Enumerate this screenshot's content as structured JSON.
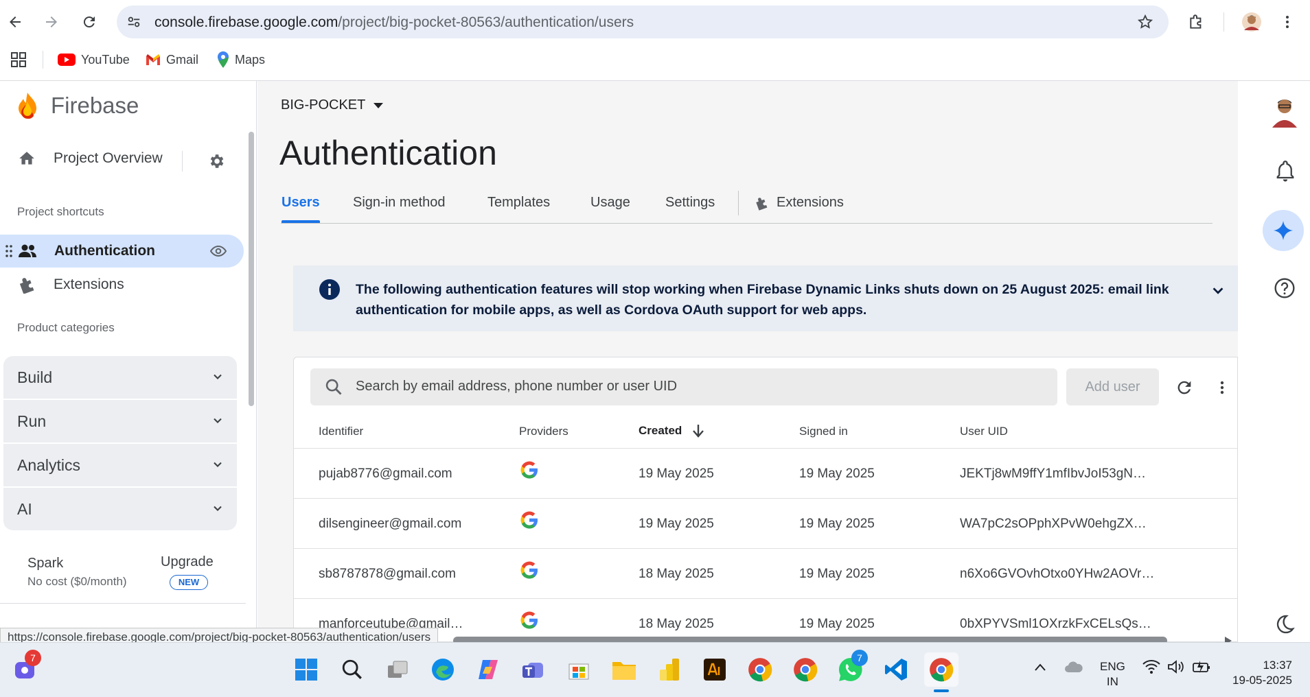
{
  "browser": {
    "url_domain": "console.firebase.google.com",
    "url_path": "/project/big-pocket-80563/authentication/users",
    "bookmarks": [
      {
        "label": "YouTube",
        "icon": "youtube-icon"
      },
      {
        "label": "Gmail",
        "icon": "gmail-icon"
      },
      {
        "label": "Maps",
        "icon": "maps-icon"
      }
    ],
    "status_url": "https://console.firebase.google.com/project/big-pocket-80563/authentication/users"
  },
  "sidebar": {
    "brand": "Firebase",
    "project_overview": "Project Overview",
    "shortcuts_heading": "Project shortcuts",
    "shortcuts": [
      {
        "label": "Authentication",
        "icon": "people-icon",
        "active": true
      },
      {
        "label": "Extensions",
        "icon": "extensions-icon",
        "active": false
      }
    ],
    "categories_heading": "Product categories",
    "categories": [
      "Build",
      "Run",
      "Analytics",
      "AI"
    ],
    "plan": {
      "name": "Spark",
      "cost": "No cost ($0/month)",
      "upgrade": "Upgrade",
      "badge": "NEW"
    }
  },
  "main": {
    "project": "BIG-POCKET",
    "title": "Authentication",
    "tabs": [
      "Users",
      "Sign-in method",
      "Templates",
      "Usage",
      "Settings",
      "Extensions"
    ],
    "active_tab": "Users",
    "banner_line1": "The following authentication features will stop working when Firebase Dynamic Links shuts down on 25 August 2025: email link",
    "banner_line2": "authentication for mobile apps, as well as Cordova OAuth support for web apps.",
    "search_placeholder": "Search by email address, phone number or user UID",
    "add_user": "Add user",
    "columns": {
      "identifier": "Identifier",
      "providers": "Providers",
      "created": "Created",
      "signed_in": "Signed in",
      "uid": "User UID"
    },
    "users": [
      {
        "identifier": "pujab8776@gmail.com",
        "created": "19 May 2025",
        "signed_in": "19 May 2025",
        "uid": "JEKTj8wM9ffY1mfIbvJoI53gN…"
      },
      {
        "identifier": "dilsengineer@gmail.com",
        "created": "19 May 2025",
        "signed_in": "19 May 2025",
        "uid": "WA7pC2sOPphXPvW0ehgZX…"
      },
      {
        "identifier": "sb8787878@gmail.com",
        "created": "18 May 2025",
        "signed_in": "19 May 2025",
        "uid": "n6Xo6GVOvhOtxo0YHw2AOVr…"
      },
      {
        "identifier": "manforceutube@gmail…",
        "created": "18 May 2025",
        "signed_in": "19 May 2025",
        "uid": "0bXPYVSml1OXrzkFxCELsQs…"
      }
    ]
  },
  "taskbar": {
    "notification_count": "7",
    "whatsapp_count": "7",
    "language": "ENG",
    "region": "IN",
    "time": "13:37",
    "date": "19-05-2025"
  },
  "colors": {
    "accent": "#1a73e8",
    "active_nav": "#d3e3fd",
    "banner": "#e8ecf3"
  }
}
